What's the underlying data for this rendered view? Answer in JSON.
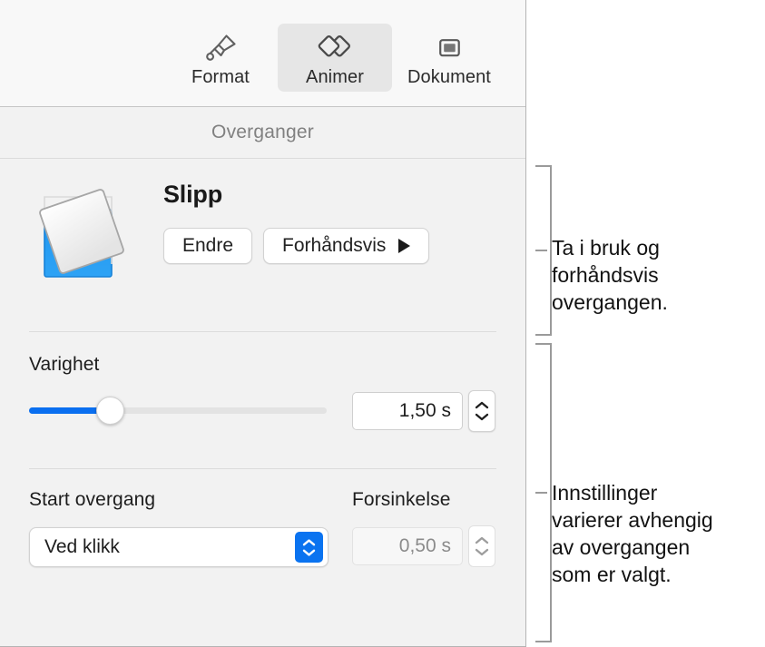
{
  "window": {
    "app_context": "Keynote transitions inspector (Norwegian)"
  },
  "tabbar": {
    "tabs": [
      {
        "label": "Format",
        "icon": "paintbrush-icon",
        "selected": false
      },
      {
        "label": "Animer",
        "icon": "transition-diamonds-icon",
        "selected": true
      },
      {
        "label": "Dokument",
        "icon": "document-slide-icon",
        "selected": false
      }
    ]
  },
  "section": {
    "title": "Overganger"
  },
  "transition": {
    "thumbnail_icon": "flip-transition-thumbnail",
    "name": "Slipp",
    "change_button": "Endre",
    "preview_button": "Forhåndsvis",
    "preview_play_icon": "play-triangle-icon"
  },
  "duration": {
    "label": "Varighet",
    "slider_percent": 25,
    "value": "1,50 s",
    "stepper_icon": "stepper-up-down-icon"
  },
  "start": {
    "label": "Start overgang",
    "selected_option": "Ved klikk",
    "popup_icon": "popup-updown-chevrons-icon"
  },
  "delay": {
    "label": "Forsinkelse",
    "value": "0,50 s",
    "disabled": true,
    "stepper_icon": "stepper-up-down-icon"
  },
  "callouts": [
    {
      "id": "apply-preview",
      "text": "Ta i bruk og\nforhåndsvis\novergangen."
    },
    {
      "id": "settings-vary",
      "text": "Innstillinger\nvarierer avhengig\nav overgangen\nsom er valgt."
    }
  ],
  "colors": {
    "accent_blue": "#0a6ff0",
    "popup_blue": "#0a73f0",
    "panel_bg": "#f2f2f2",
    "tabbar_bg": "#f8f8f8",
    "selected_tab_bg": "#e6e6e6",
    "bracket_gray": "#9a9a9a",
    "thumb_blue": "#2a9bef"
  }
}
